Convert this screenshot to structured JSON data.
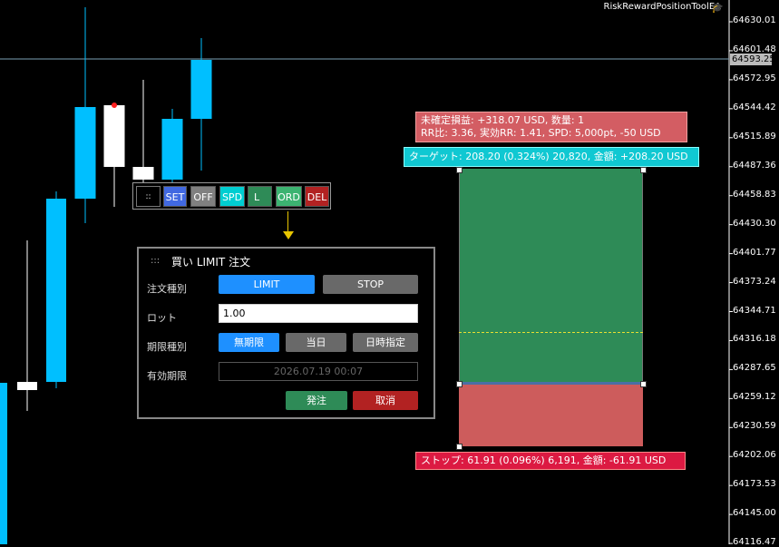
{
  "ea_name": "RiskRewardPositionToolEA",
  "price_axis": {
    "labels": [
      "64630.01",
      "64601.48",
      "64572.95",
      "64544.42",
      "64515.89",
      "64487.36",
      "64458.83",
      "64430.30",
      "64401.77",
      "64373.24",
      "64344.71",
      "64316.18",
      "64287.65",
      "64259.12",
      "64230.59",
      "64202.06",
      "64173.53",
      "64145.00",
      "64116.47"
    ],
    "current_price": "64593.25"
  },
  "toolbar": {
    "grip": "::",
    "set": "SET",
    "off": "OFF",
    "spd": "SPD",
    "l": "L",
    "ord": "ORD",
    "del": "DEL"
  },
  "dialog": {
    "grip": ":::",
    "title": "買い LIMIT 注文",
    "order_type_label": "注文種別",
    "limit_button": "LIMIT",
    "stop_button": "STOP",
    "lot_label": "ロット",
    "lot_value": "1.00",
    "expiry_type_label": "期限種別",
    "no_expiry_button": "無期限",
    "today_button": "当日",
    "datetime_button": "日時指定",
    "expiry_label": "有効期限",
    "expiry_value": "2026.07.19 00:07",
    "send_button": "発注",
    "cancel_button": "取消"
  },
  "overlay": {
    "info_line1": "未確定損益: +318.07 USD, 数量: 1",
    "info_line2": "RR比: 3.36, 実効RR: 1.41, SPD: 5,000pt, -50 USD",
    "target_text": "ターゲット: 208.20 (0.324%) 20,820, 金額: +208.20 USD",
    "stop_text": "ストップ: 61.91 (0.096%) 6,191, 金額: -61.91 USD"
  },
  "colors": {
    "candle_bull": "#00bfff",
    "candle_bear": "#ffffff",
    "profit_zone": "#2e8b57",
    "loss_zone": "#cd5c5c",
    "set_button": "#4169e1",
    "spd_button": "#00ced1",
    "ord_button": "#3cb371",
    "del_button": "#b22222",
    "limit_active": "#1e90ff"
  }
}
